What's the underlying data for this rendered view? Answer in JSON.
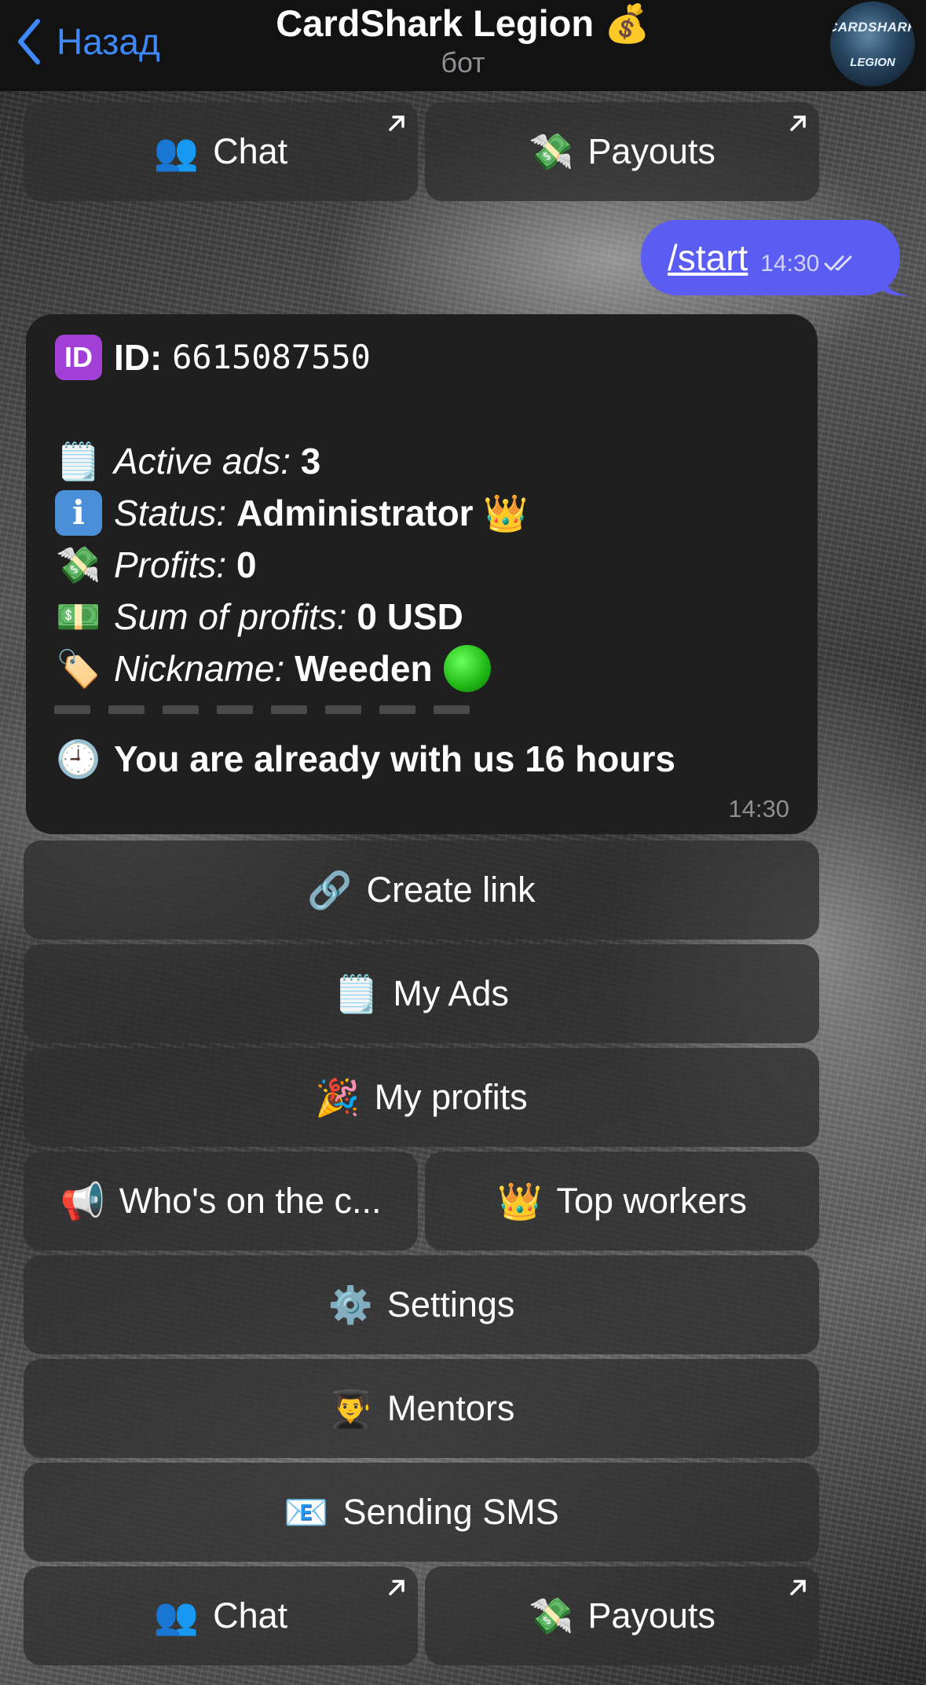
{
  "header": {
    "back_label": "Назад",
    "title": "CardShark Legion 💰",
    "subtitle": "бот",
    "avatar_line1": "CARDSHARK",
    "avatar_line2": "LEGION"
  },
  "top_buttons": [
    {
      "emoji": "👥",
      "label": "Chat"
    },
    {
      "emoji": "💸",
      "label": "Payouts"
    }
  ],
  "outgoing": {
    "text": "/start",
    "time": "14:30"
  },
  "profile": {
    "id_label": "ID:",
    "id_value": "6615087550",
    "active_ads_label": "Active ads:",
    "active_ads_value": "3",
    "status_label": "Status:",
    "status_value": "Administrator",
    "status_emoji": "👑",
    "profits_label": "Profits:",
    "profits_value": "0",
    "sum_label": "Sum of profits:",
    "sum_value": "0 USD",
    "nickname_label": "Nickname:",
    "nickname_value": "Weeden",
    "tenure": "You are already with us 16 hours",
    "time": "14:30",
    "icons": {
      "id": "ID",
      "ads": "🗒️",
      "status": "i",
      "profits": "💸",
      "sum": "💵",
      "nickname": "🏷️",
      "clock": "🕘"
    }
  },
  "keyboard": {
    "create_link": {
      "emoji": "🔗",
      "label": "Create link"
    },
    "my_ads": {
      "emoji": "🗒️",
      "label": "My Ads"
    },
    "my_profits": {
      "emoji": "🎉",
      "label": "My profits"
    },
    "whos_on": {
      "emoji": "📢",
      "label": "Who's on the c..."
    },
    "top_workers": {
      "emoji": "👑",
      "label": "Top workers"
    },
    "settings": {
      "emoji": "⚙️",
      "label": "Settings"
    },
    "mentors": {
      "emoji": "👨‍🎓",
      "label": "Mentors"
    },
    "sending_sms": {
      "emoji": "📧",
      "label": "Sending SMS"
    }
  },
  "bottom_buttons": [
    {
      "emoji": "👥",
      "label": "Chat"
    },
    {
      "emoji": "💸",
      "label": "Payouts"
    }
  ],
  "colors": {
    "accent": "#3e88f7",
    "outgoing_bubble": "#5b5cf2",
    "incoming_bubble": "#1f1f1f"
  }
}
